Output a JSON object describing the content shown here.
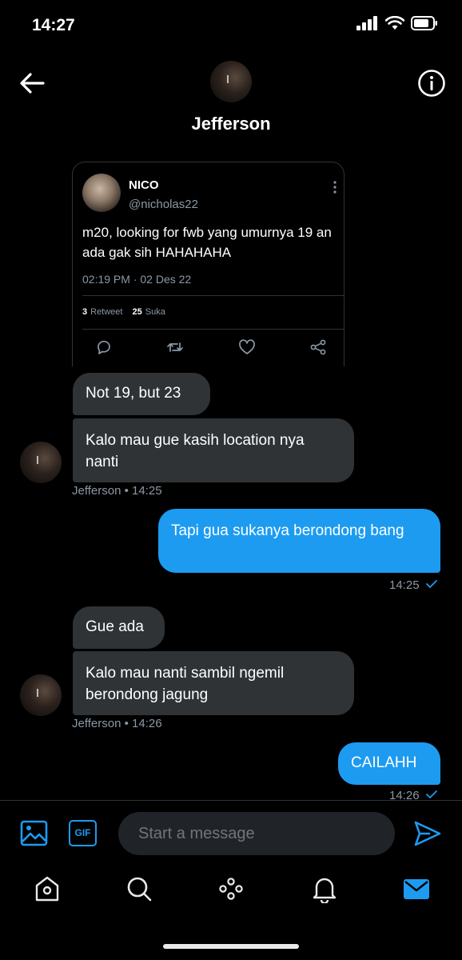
{
  "status_bar": {
    "time": "14:27",
    "icons": [
      "signal-icon",
      "wifi-icon",
      "battery-icon"
    ]
  },
  "header": {
    "name": "Jefferson",
    "back_icon": "arrow-left-icon",
    "info_icon": "info-icon"
  },
  "tweet": {
    "name": "NICO",
    "handle": "@nicholas22",
    "text": "m20, looking for fwb yang umurnya 19 an ada gak sih HAHAHAHA",
    "datetime": "02:19 PM · 02 Des 22",
    "retweet_count": "3",
    "retweet_label": "Retweet",
    "like_count": "25",
    "like_label": "Suka",
    "actions": [
      "reply-icon",
      "retweet-icon",
      "like-icon",
      "share-icon"
    ]
  },
  "messages": [
    {
      "direction": "in",
      "text": "Not 19, but 23"
    },
    {
      "direction": "in",
      "text": "Kalo mau gue kasih location nya nanti",
      "meta": "Jefferson • 14:25"
    },
    {
      "direction": "out",
      "text": "Tapi gua sukanya berondong bang",
      "meta": "14:25"
    },
    {
      "direction": "in",
      "text": "Gue ada"
    },
    {
      "direction": "in",
      "text": "Kalo mau nanti sambil ngemil berondong jagung",
      "meta": "Jefferson • 14:26"
    },
    {
      "direction": "out",
      "text": "CAILAHH",
      "meta": "14:26"
    }
  ],
  "compose": {
    "placeholder": "Start a message",
    "gif_label": "GIF"
  },
  "nav": {
    "tabs": [
      "home-icon",
      "search-icon",
      "spaces-icon",
      "notifications-icon",
      "messages-icon"
    ],
    "active": "messages-icon"
  },
  "colors": {
    "accent": "#1d9bf0",
    "background": "#000000",
    "bubble_in": "#2f3336",
    "muted": "#8b98a5"
  }
}
